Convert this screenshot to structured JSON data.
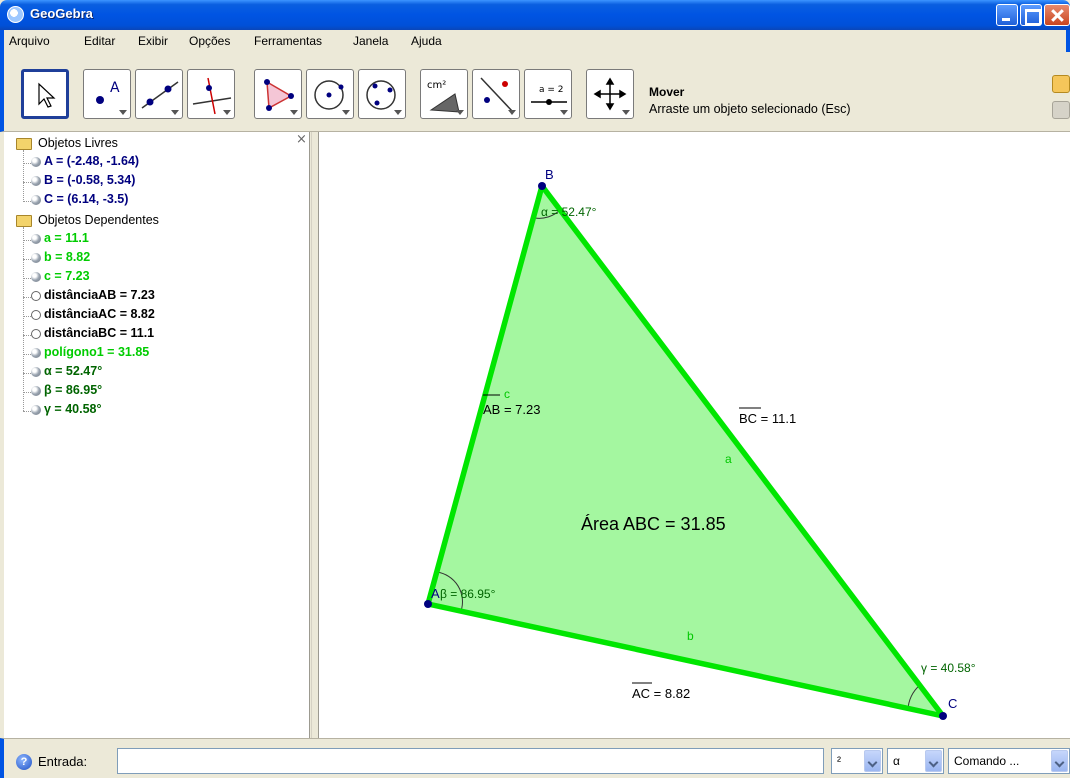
{
  "window": {
    "title": "GeoGebra"
  },
  "menu": [
    "Arquivo",
    "Editar",
    "Exibir",
    "Opções",
    "Ferramentas",
    "Janela",
    "Ajuda"
  ],
  "toolbar": {
    "tools": [
      "move-tool",
      "point-tool",
      "line-tool",
      "perpendicular-tool",
      "polygon-tool",
      "circle-tool",
      "circle-three-points-tool",
      "area-tool",
      "reflect-tool",
      "slider-tool",
      "move-view-tool"
    ],
    "area_icon_text": "cm²",
    "slider_icon_text": "a = 2",
    "active_tool_name": "Mover",
    "active_tool_help": "Arraste um objeto selecionado (Esc)"
  },
  "algebra": {
    "free_folder": "Objetos Livres",
    "free_objects": [
      {
        "text": "A = (-2.48, -1.64)",
        "color": "#00007f",
        "bullet": "filled"
      },
      {
        "text": "B = (-0.58, 5.34)",
        "color": "#00007f",
        "bullet": "filled"
      },
      {
        "text": "C = (6.14, -3.5)",
        "color": "#00007f",
        "bullet": "filled"
      }
    ],
    "dependent_folder": "Objetos Dependentes",
    "dependent_objects": [
      {
        "text": "a = 11.1",
        "color": "#00cc00",
        "bullet": "filled"
      },
      {
        "text": "b = 8.82",
        "color": "#00cc00",
        "bullet": "filled"
      },
      {
        "text": "c = 7.23",
        "color": "#00cc00",
        "bullet": "filled"
      },
      {
        "text": "distânciaAB = 7.23",
        "color": "#000000",
        "bullet": "hollow"
      },
      {
        "text": "distânciaAC = 8.82",
        "color": "#000000",
        "bullet": "hollow"
      },
      {
        "text": "distânciaBC = 11.1",
        "color": "#000000",
        "bullet": "hollow"
      },
      {
        "text": "polígono1 = 31.85",
        "color": "#00cc00",
        "bullet": "filled"
      },
      {
        "text": "α = 52.47°",
        "color": "#006400",
        "bullet": "filled"
      },
      {
        "text": "β = 86.95°",
        "color": "#006400",
        "bullet": "filled"
      },
      {
        "text": "γ = 40.58°",
        "color": "#006400",
        "bullet": "filled"
      }
    ],
    "close_symbol": "×"
  },
  "graphics": {
    "points": [
      {
        "label": "A"
      },
      {
        "label": "B"
      },
      {
        "label": "C"
      }
    ],
    "sides": [
      {
        "label": "a"
      },
      {
        "label": "b"
      },
      {
        "label": "c"
      }
    ],
    "distances": [
      {
        "text": "AB = 7.23"
      },
      {
        "text": "BC = 11.1"
      },
      {
        "text": "AC = 8.82"
      }
    ],
    "angles": [
      {
        "text": "α = 52.47°"
      },
      {
        "text": "β = 86.95°"
      },
      {
        "text": "γ = 40.58°"
      }
    ],
    "area_text": "Área ABC = 31.85",
    "polygon_fill": "#a4f7a0",
    "edge_color": "#00e600",
    "point_color": "#00007f",
    "angle_color": "#006400"
  },
  "input": {
    "help_symbol": "?",
    "label": "Entrada:",
    "value": "",
    "combo1": "²",
    "combo2": "α",
    "combo3": "Comando ..."
  }
}
